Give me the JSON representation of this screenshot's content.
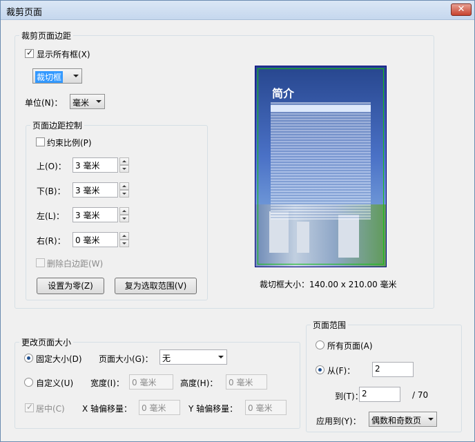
{
  "window": {
    "title": "裁剪页面",
    "close_label": "✕"
  },
  "margins": {
    "legend": "裁剪页面边距",
    "show_all_boxes_label": "显示所有框(X)",
    "show_all_boxes_checked": true,
    "box_select": "裁切框",
    "unit_label": "单位(N)：",
    "unit_select": "毫米",
    "control": {
      "legend": "页面边距控制",
      "constrain_label": "约束比例(P)",
      "top_label": "上(O)：",
      "top_value": "3 毫米",
      "bottom_label": "下(B)：",
      "bottom_value": "3 毫米",
      "left_label": "左(L)：",
      "left_value": "3 毫米",
      "right_label": "右(R)：",
      "right_value": "0 毫米",
      "remove_white_label": "删除白边距(W)",
      "set_zero_button": "设置为零(Z)",
      "restore_button": "复为选取范围(V)"
    }
  },
  "preview": {
    "page_title": "简介",
    "crop_size_text": "裁切框大小：140.00 x 210.00 毫米"
  },
  "page_size": {
    "legend": "更改页面大小",
    "fixed_label": "固定大小(D)",
    "fixed_selected": true,
    "page_size_label": "页面大小(G)：",
    "page_size_select": "无",
    "custom_label": "自定义(U)",
    "width_label": "宽度(I)：",
    "width_value": "0 毫米",
    "height_label": "高度(H)：",
    "height_value": "0 毫米",
    "center_label": "居中(C)",
    "center_checked": true,
    "x_offset_label": "X 轴偏移量：",
    "x_offset_value": "0 毫米",
    "y_offset_label": "Y 轴偏移量：",
    "y_offset_value": "0 毫米"
  },
  "page_range": {
    "legend": "页面范围",
    "all_label": "所有页面(A)",
    "from_label": "从(F)：",
    "from_value": "2",
    "to_label": "到(T)：",
    "to_value": "2",
    "total": "/ 70",
    "apply_label": "应用到(Y)：",
    "apply_select": "偶数和奇数页"
  }
}
